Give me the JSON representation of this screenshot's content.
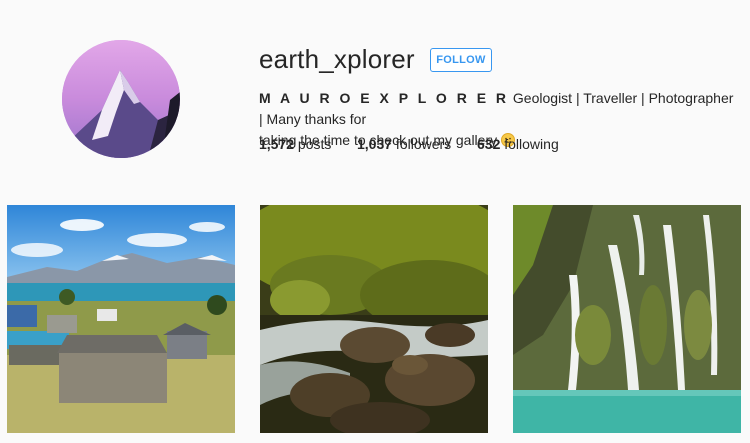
{
  "profile": {
    "username": "earth_xplorer",
    "follow_label": "FOLLOW",
    "display_name": "M A U R O E X P L O R E R",
    "bio_line1": " Geologist | Traveller | Photographer | Many thanks for",
    "bio_line2": "taking the time to check out my gallery ",
    "emoji": "smiling-face-emoji"
  },
  "stats": {
    "posts_count": "1,572",
    "posts_label": " posts",
    "followers_count": "1,037",
    "followers_label": " followers",
    "following_count": "632",
    "following_label": " following"
  },
  "photos": [
    {
      "subject": "lakeside-village-with-mountains"
    },
    {
      "subject": "mossy-forest-stream"
    },
    {
      "subject": "waterfalls-over-cliff-into-turquoise-water"
    }
  ],
  "colors": {
    "accent": "#3897f0",
    "text": "#262626",
    "background": "#fafafa"
  }
}
